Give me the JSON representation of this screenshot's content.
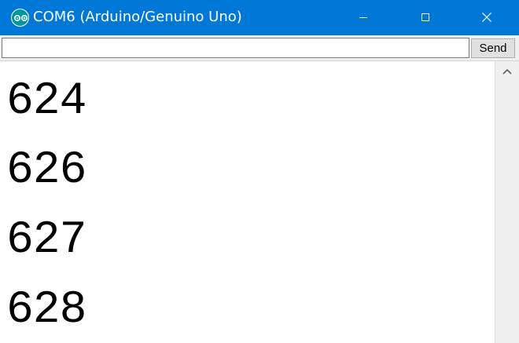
{
  "window": {
    "title": "COM6 (Arduino/Genuino Uno)",
    "accent_color": "#0078d7",
    "app_icon": "arduino-logo-icon"
  },
  "controls": {
    "minimize_icon": "minimize-icon",
    "maximize_icon": "maximize-icon",
    "close_icon": "close-icon"
  },
  "input_row": {
    "value": "",
    "send_label": "Send"
  },
  "output": {
    "lines": [
      "624",
      "626",
      "627",
      "628"
    ]
  },
  "scrollbar": {
    "up_icon": "chevron-up-icon"
  }
}
